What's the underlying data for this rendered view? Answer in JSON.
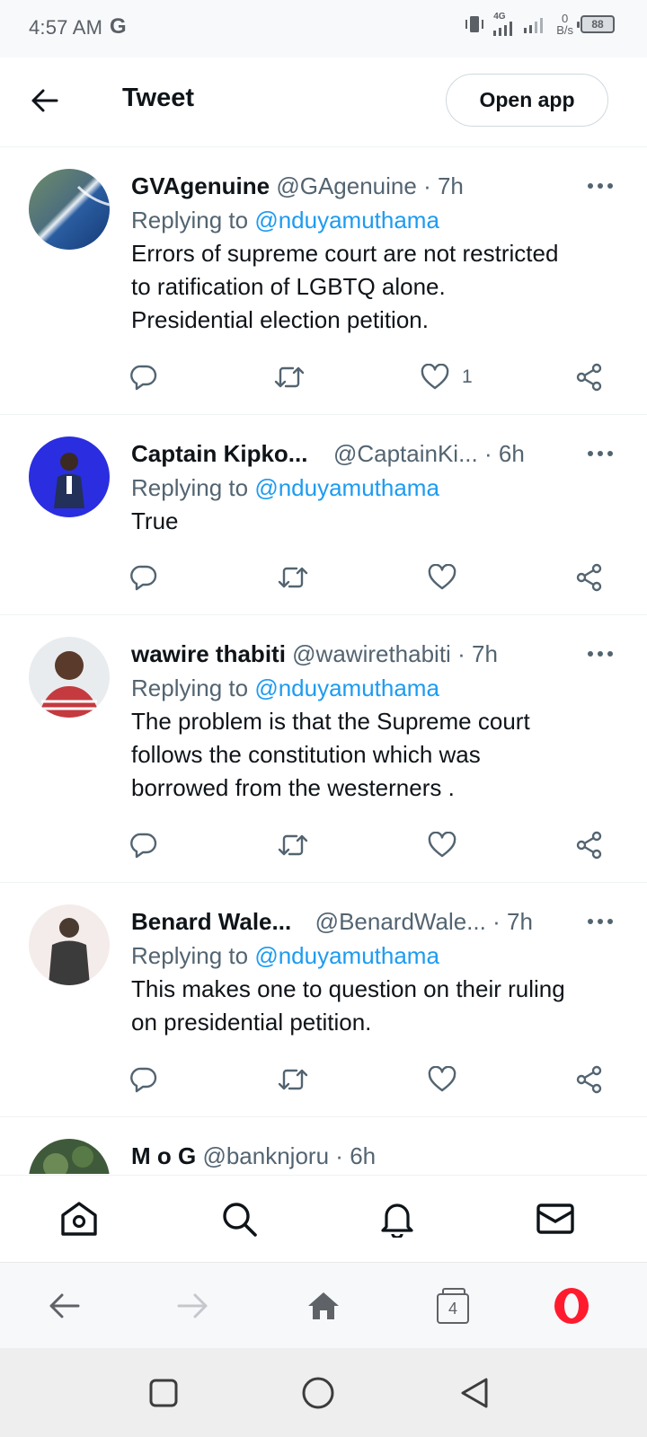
{
  "status_bar": {
    "time": "4:57 AM",
    "carrier_logo": "G",
    "network": "4G",
    "speed_value": "0",
    "speed_unit": "B/s",
    "battery": "88"
  },
  "header": {
    "title": "Tweet",
    "open_app_label": "Open app"
  },
  "reply_prefix": "Replying to",
  "tweets": [
    {
      "display_name": "GVAgenuine",
      "handle": "@GAgenuine",
      "time": "7h",
      "reply_to": "@nduyamuthama",
      "text_lines": [
        "Errors of supreme court are not restricted",
        "to ratification of LGBTQ alone.",
        "Presidential election petition."
      ],
      "like_count": "1"
    },
    {
      "display_name": "Captain Kipko...",
      "handle": "@CaptainKi...",
      "time": "6h",
      "reply_to": "@nduyamuthama",
      "text_lines": [
        "True"
      ],
      "like_count": ""
    },
    {
      "display_name": "wawire thabiti",
      "handle": "@wawirethabiti",
      "time": "7h",
      "reply_to": "@nduyamuthama",
      "text_lines": [
        "The problem is that the Supreme court",
        "follows the constitution which was",
        "borrowed from the westerners ."
      ],
      "like_count": ""
    },
    {
      "display_name": "Benard Wale...",
      "handle": "@BenardWale...",
      "time": "7h",
      "reply_to": "@nduyamuthama",
      "text_lines": [
        "This makes one to question on their ruling",
        "on presidential petition."
      ],
      "like_count": ""
    }
  ],
  "partial_tweet": {
    "display_name": "M o G",
    "handle": "@banknjoru",
    "time": "6h"
  },
  "browser": {
    "tab_count": "4"
  },
  "icons": {
    "back": "arrow-left-icon",
    "more": "more-horizontal-icon",
    "reply": "reply-icon",
    "retweet": "retweet-icon",
    "like": "heart-icon",
    "share": "share-icon",
    "home": "home-icon",
    "search": "search-icon",
    "notifications": "bell-icon",
    "messages": "mail-icon",
    "browser_logo": "opera-icon"
  },
  "colors": {
    "link": "#1d9bf0",
    "text": "#0f1419",
    "secondary": "#536471",
    "opera_red": "#ff1b2d"
  }
}
